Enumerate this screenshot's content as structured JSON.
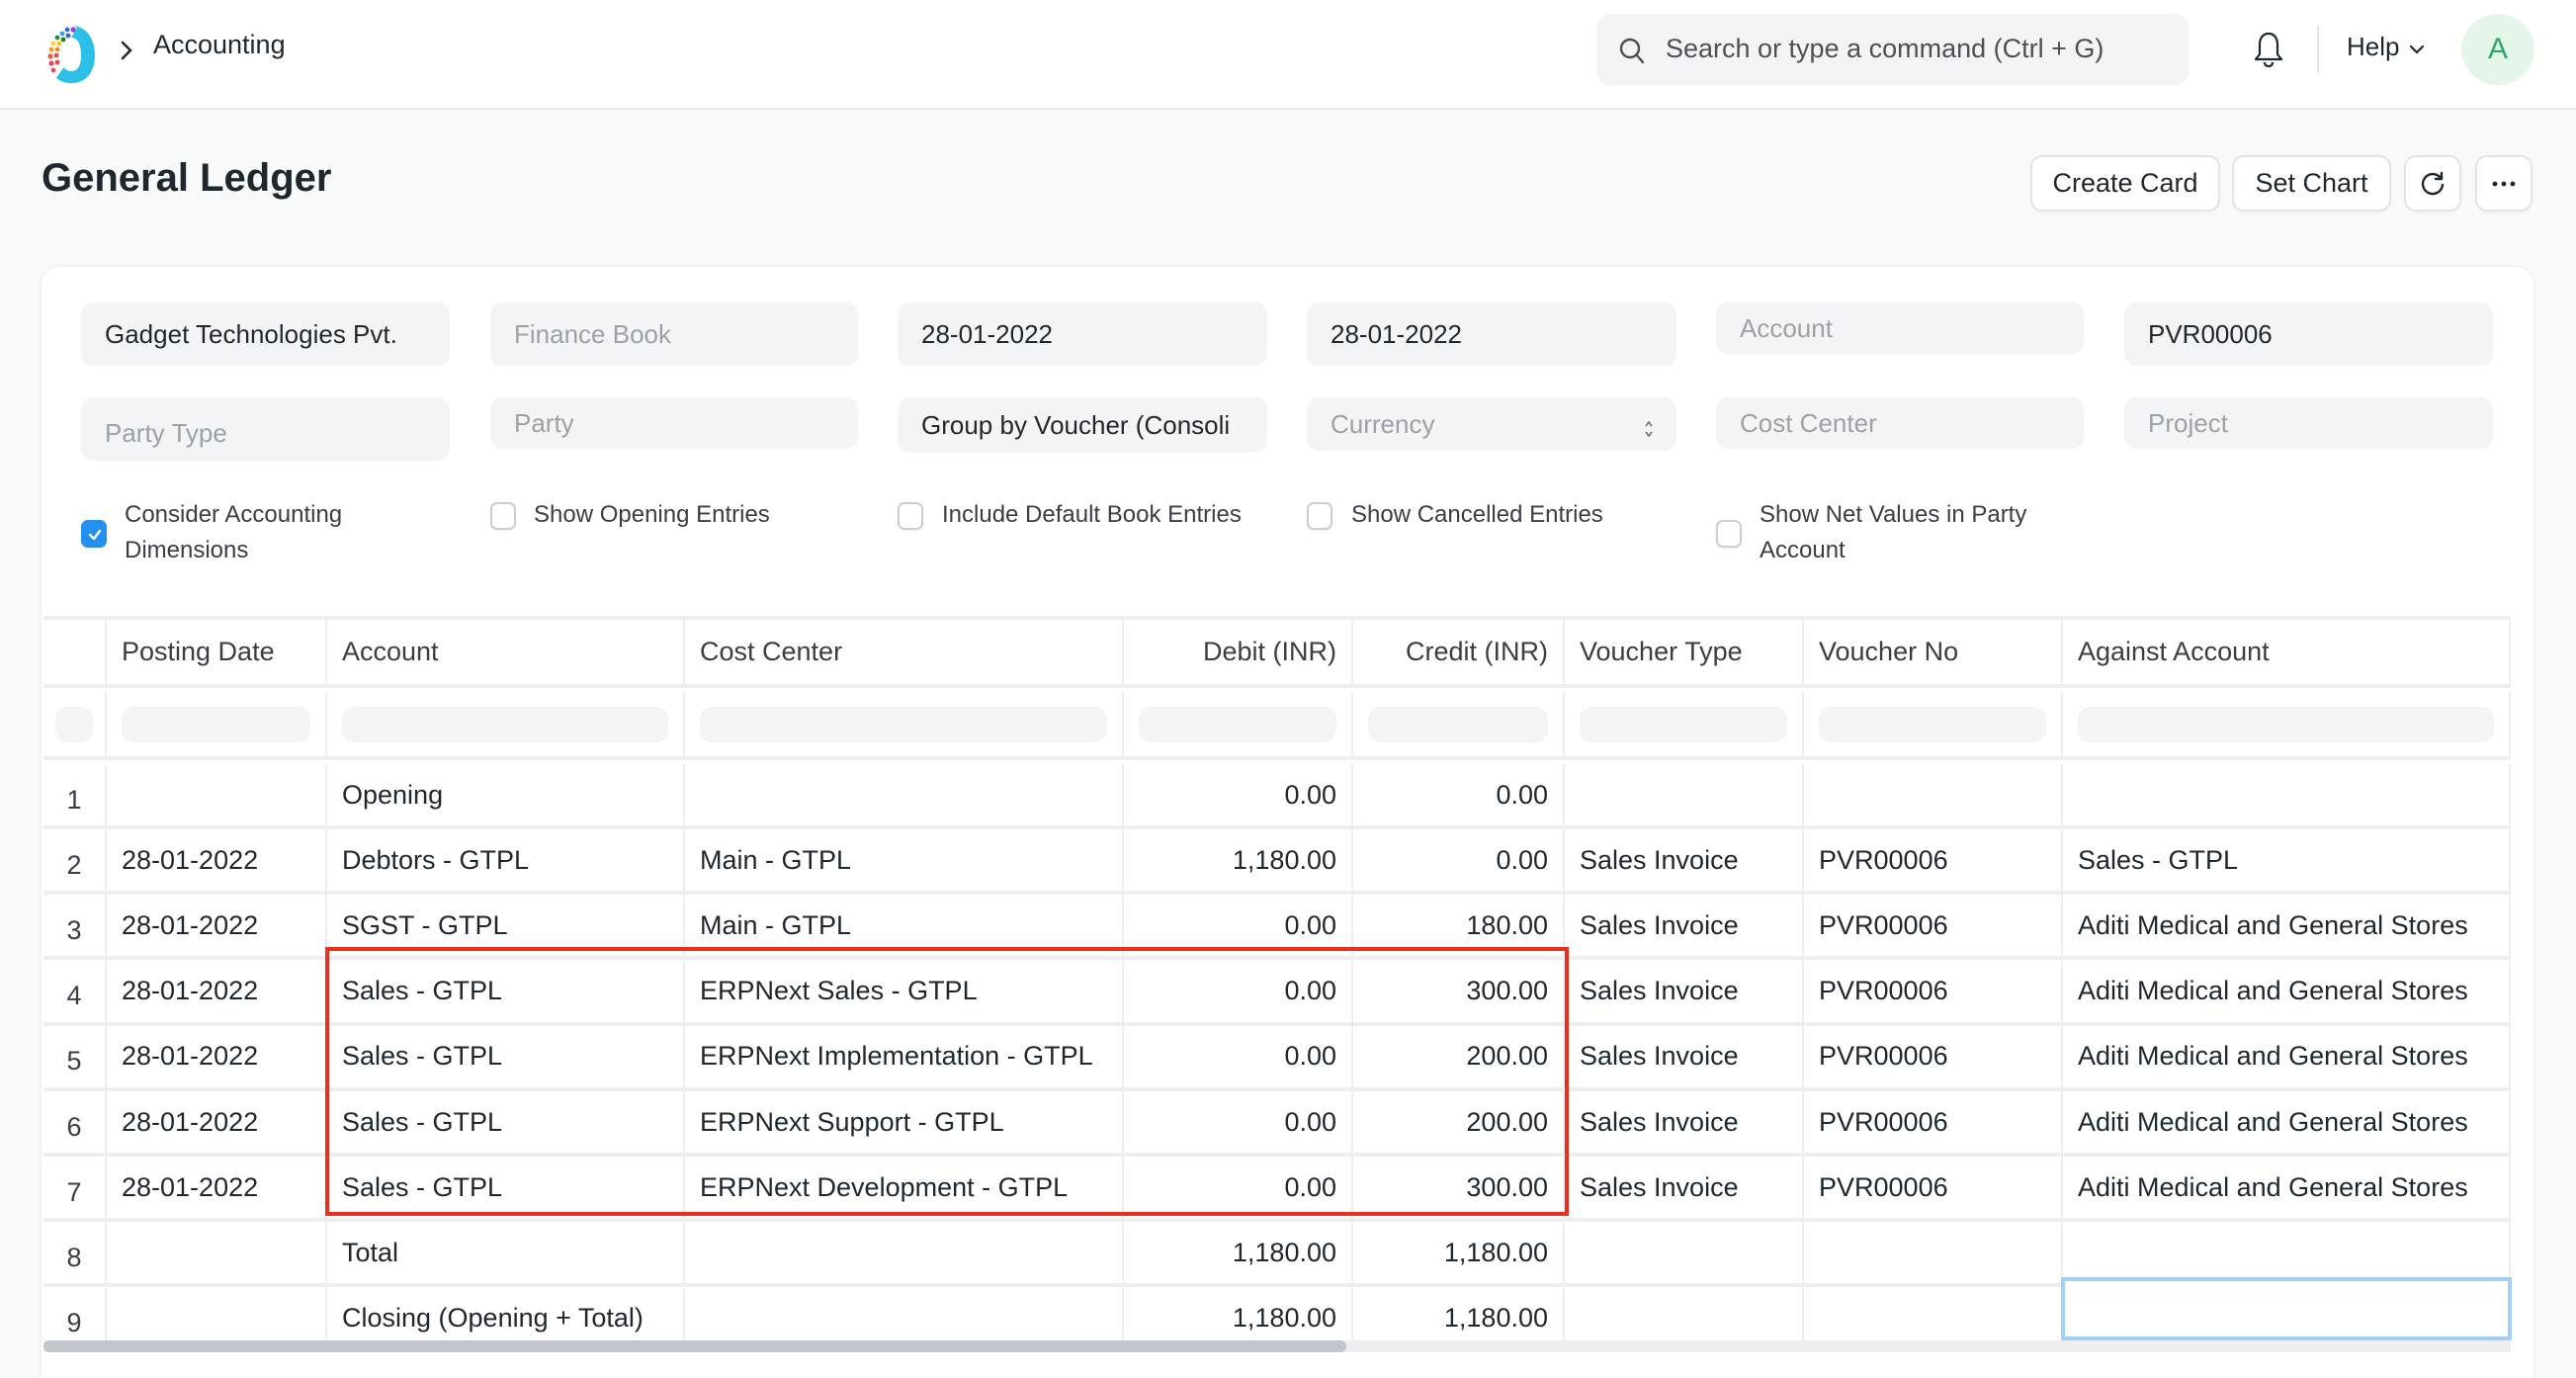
{
  "navbar": {
    "breadcrumb": "Accounting",
    "search_placeholder": "Search or type a command (Ctrl + G)",
    "help_label": "Help",
    "avatar_initial": "A"
  },
  "page": {
    "title": "General Ledger",
    "buttons": {
      "create_card": "Create Card",
      "set_chart": "Set Chart",
      "refresh_icon": "refresh-icon",
      "more_icon": "ellipsis-icon"
    }
  },
  "filters": {
    "company": "Gadget Technologies Pvt.",
    "finance_book_placeholder": "Finance Book",
    "from_date": "28-01-2022",
    "to_date": "28-01-2022",
    "account_placeholder": "Account",
    "voucher_no": "PVR00006",
    "party_type_placeholder": "Party Type",
    "party_placeholder": "Party",
    "group_by": "Group by Voucher (Consoli",
    "currency_placeholder": "Currency",
    "cost_center_placeholder": "Cost Center",
    "project_placeholder": "Project"
  },
  "checkboxes": [
    {
      "label": "Consider Accounting Dimensions",
      "checked": true
    },
    {
      "label": "Show Opening Entries",
      "checked": false
    },
    {
      "label": "Include Default Book Entries",
      "checked": false
    },
    {
      "label": "Show Cancelled Entries",
      "checked": false
    },
    {
      "label": "Show Net Values in Party Account",
      "checked": false
    }
  ],
  "table": {
    "columns": [
      "",
      "Posting Date",
      "Account",
      "Cost Center",
      "Debit (INR)",
      "Credit (INR)",
      "Voucher Type",
      "Voucher No",
      "Against Account"
    ],
    "rows": [
      {
        "n": "1",
        "date": "",
        "account": "Opening",
        "cost_center": "",
        "debit": "0.00",
        "credit": "0.00",
        "voucher_type": "",
        "voucher_no": "",
        "against": ""
      },
      {
        "n": "2",
        "date": "28-01-2022",
        "account": "Debtors - GTPL",
        "cost_center": "Main - GTPL",
        "debit": "1,180.00",
        "credit": "0.00",
        "voucher_type": "Sales Invoice",
        "voucher_no": "PVR00006",
        "against": "Sales - GTPL"
      },
      {
        "n": "3",
        "date": "28-01-2022",
        "account": "SGST - GTPL",
        "cost_center": "Main - GTPL",
        "debit": "0.00",
        "credit": "180.00",
        "voucher_type": "Sales Invoice",
        "voucher_no": "PVR00006",
        "against": "Aditi Medical and General Stores"
      },
      {
        "n": "4",
        "date": "28-01-2022",
        "account": "Sales - GTPL",
        "cost_center": "ERPNext Sales - GTPL",
        "debit": "0.00",
        "credit": "300.00",
        "voucher_type": "Sales Invoice",
        "voucher_no": "PVR00006",
        "against": "Aditi Medical and General Stores"
      },
      {
        "n": "5",
        "date": "28-01-2022",
        "account": "Sales - GTPL",
        "cost_center": "ERPNext Implementation - GTPL",
        "debit": "0.00",
        "credit": "200.00",
        "voucher_type": "Sales Invoice",
        "voucher_no": "PVR00006",
        "against": "Aditi Medical and General Stores"
      },
      {
        "n": "6",
        "date": "28-01-2022",
        "account": "Sales - GTPL",
        "cost_center": "ERPNext Support - GTPL",
        "debit": "0.00",
        "credit": "200.00",
        "voucher_type": "Sales Invoice",
        "voucher_no": "PVR00006",
        "against": "Aditi Medical and General Stores"
      },
      {
        "n": "7",
        "date": "28-01-2022",
        "account": "Sales - GTPL",
        "cost_center": "ERPNext Development - GTPL",
        "debit": "0.00",
        "credit": "300.00",
        "voucher_type": "Sales Invoice",
        "voucher_no": "PVR00006",
        "against": "Aditi Medical and General Stores"
      },
      {
        "n": "8",
        "date": "",
        "account": "Total",
        "cost_center": "",
        "debit": "1,180.00",
        "credit": "1,180.00",
        "voucher_type": "",
        "voucher_no": "",
        "against": ""
      },
      {
        "n": "9",
        "date": "",
        "account": "Closing (Opening + Total)",
        "cost_center": "",
        "debit": "1,180.00",
        "credit": "1,180.00",
        "voucher_type": "",
        "voucher_no": "",
        "against": ""
      }
    ]
  },
  "colors": {
    "accent": "#2490ef",
    "highlight_border": "#ec2f1c",
    "focus_border": "#a4cff5"
  }
}
